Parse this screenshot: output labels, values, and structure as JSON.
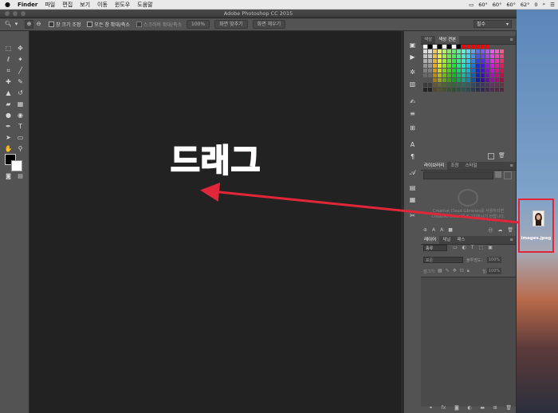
{
  "menubar": {
    "apple": "",
    "app": "Finder",
    "items": [
      "파일",
      "편집",
      "보기",
      "이동",
      "윈도우",
      "도움말"
    ],
    "status": [
      "60°",
      "60°",
      "60°",
      "62°",
      "0"
    ]
  },
  "window": {
    "title": "Adobe Photoshop CC 2015"
  },
  "options_bar": {
    "checkbox1": "창 크기 조정",
    "checkbox2": "모든 창 확대/축소",
    "scrubby": "스크러비 확대/축소",
    "zoom_btn": "100%",
    "fit_btn": "화면 맞추기",
    "fill_btn": "화면 채우기",
    "workspace": "필수"
  },
  "canvas": {
    "overlay_text": "드래그"
  },
  "panels": {
    "color": {
      "tabs": [
        "색상",
        "색상 견본"
      ]
    },
    "libraries": {
      "tabs": [
        "라이브러리",
        "조정",
        "스타일"
      ],
      "message_line1": "Creative Cloud Libraries를 사용하려면",
      "message_line2": "Creative Cloud에 로그인하시기 바랍니다."
    },
    "layers": {
      "tabs": [
        "레이어",
        "채널",
        "패스"
      ],
      "filter": "종류",
      "blend": "표준",
      "opacity_label": "불투명도:",
      "opacity_value": "100%",
      "fill_label": "칠:",
      "fill_value": "100%",
      "lock_label": "잠그기:"
    }
  },
  "desktop": {
    "file_name": "images.jpeg"
  },
  "colors": {
    "accent_red": "#d9304f",
    "highlight_border": "#e2263a",
    "panel_bg": "#535353",
    "canvas_bg": "#222222"
  }
}
